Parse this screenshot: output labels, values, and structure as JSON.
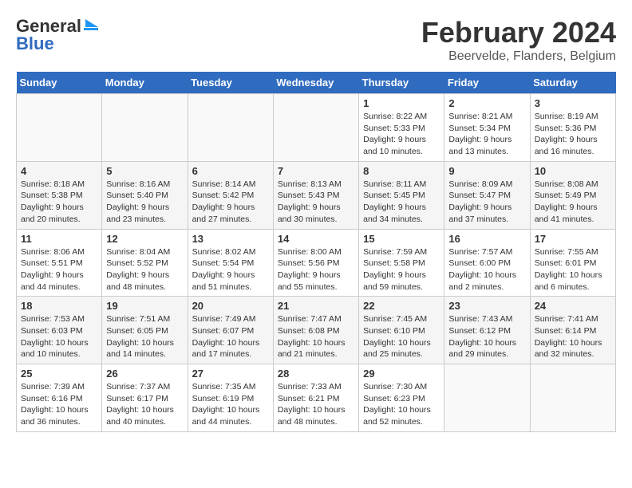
{
  "logo": {
    "line1": "General",
    "line2": "Blue"
  },
  "title": "February 2024",
  "subtitle": "Beervelde, Flanders, Belgium",
  "weekdays": [
    "Sunday",
    "Monday",
    "Tuesday",
    "Wednesday",
    "Thursday",
    "Friday",
    "Saturday"
  ],
  "weeks": [
    [
      {
        "day": "",
        "info": ""
      },
      {
        "day": "",
        "info": ""
      },
      {
        "day": "",
        "info": ""
      },
      {
        "day": "",
        "info": ""
      },
      {
        "day": "1",
        "info": "Sunrise: 8:22 AM\nSunset: 5:33 PM\nDaylight: 9 hours and 10 minutes."
      },
      {
        "day": "2",
        "info": "Sunrise: 8:21 AM\nSunset: 5:34 PM\nDaylight: 9 hours and 13 minutes."
      },
      {
        "day": "3",
        "info": "Sunrise: 8:19 AM\nSunset: 5:36 PM\nDaylight: 9 hours and 16 minutes."
      }
    ],
    [
      {
        "day": "4",
        "info": "Sunrise: 8:18 AM\nSunset: 5:38 PM\nDaylight: 9 hours and 20 minutes."
      },
      {
        "day": "5",
        "info": "Sunrise: 8:16 AM\nSunset: 5:40 PM\nDaylight: 9 hours and 23 minutes."
      },
      {
        "day": "6",
        "info": "Sunrise: 8:14 AM\nSunset: 5:42 PM\nDaylight: 9 hours and 27 minutes."
      },
      {
        "day": "7",
        "info": "Sunrise: 8:13 AM\nSunset: 5:43 PM\nDaylight: 9 hours and 30 minutes."
      },
      {
        "day": "8",
        "info": "Sunrise: 8:11 AM\nSunset: 5:45 PM\nDaylight: 9 hours and 34 minutes."
      },
      {
        "day": "9",
        "info": "Sunrise: 8:09 AM\nSunset: 5:47 PM\nDaylight: 9 hours and 37 minutes."
      },
      {
        "day": "10",
        "info": "Sunrise: 8:08 AM\nSunset: 5:49 PM\nDaylight: 9 hours and 41 minutes."
      }
    ],
    [
      {
        "day": "11",
        "info": "Sunrise: 8:06 AM\nSunset: 5:51 PM\nDaylight: 9 hours and 44 minutes."
      },
      {
        "day": "12",
        "info": "Sunrise: 8:04 AM\nSunset: 5:52 PM\nDaylight: 9 hours and 48 minutes."
      },
      {
        "day": "13",
        "info": "Sunrise: 8:02 AM\nSunset: 5:54 PM\nDaylight: 9 hours and 51 minutes."
      },
      {
        "day": "14",
        "info": "Sunrise: 8:00 AM\nSunset: 5:56 PM\nDaylight: 9 hours and 55 minutes."
      },
      {
        "day": "15",
        "info": "Sunrise: 7:59 AM\nSunset: 5:58 PM\nDaylight: 9 hours and 59 minutes."
      },
      {
        "day": "16",
        "info": "Sunrise: 7:57 AM\nSunset: 6:00 PM\nDaylight: 10 hours and 2 minutes."
      },
      {
        "day": "17",
        "info": "Sunrise: 7:55 AM\nSunset: 6:01 PM\nDaylight: 10 hours and 6 minutes."
      }
    ],
    [
      {
        "day": "18",
        "info": "Sunrise: 7:53 AM\nSunset: 6:03 PM\nDaylight: 10 hours and 10 minutes."
      },
      {
        "day": "19",
        "info": "Sunrise: 7:51 AM\nSunset: 6:05 PM\nDaylight: 10 hours and 14 minutes."
      },
      {
        "day": "20",
        "info": "Sunrise: 7:49 AM\nSunset: 6:07 PM\nDaylight: 10 hours and 17 minutes."
      },
      {
        "day": "21",
        "info": "Sunrise: 7:47 AM\nSunset: 6:08 PM\nDaylight: 10 hours and 21 minutes."
      },
      {
        "day": "22",
        "info": "Sunrise: 7:45 AM\nSunset: 6:10 PM\nDaylight: 10 hours and 25 minutes."
      },
      {
        "day": "23",
        "info": "Sunrise: 7:43 AM\nSunset: 6:12 PM\nDaylight: 10 hours and 29 minutes."
      },
      {
        "day": "24",
        "info": "Sunrise: 7:41 AM\nSunset: 6:14 PM\nDaylight: 10 hours and 32 minutes."
      }
    ],
    [
      {
        "day": "25",
        "info": "Sunrise: 7:39 AM\nSunset: 6:16 PM\nDaylight: 10 hours and 36 minutes."
      },
      {
        "day": "26",
        "info": "Sunrise: 7:37 AM\nSunset: 6:17 PM\nDaylight: 10 hours and 40 minutes."
      },
      {
        "day": "27",
        "info": "Sunrise: 7:35 AM\nSunset: 6:19 PM\nDaylight: 10 hours and 44 minutes."
      },
      {
        "day": "28",
        "info": "Sunrise: 7:33 AM\nSunset: 6:21 PM\nDaylight: 10 hours and 48 minutes."
      },
      {
        "day": "29",
        "info": "Sunrise: 7:30 AM\nSunset: 6:23 PM\nDaylight: 10 hours and 52 minutes."
      },
      {
        "day": "",
        "info": ""
      },
      {
        "day": "",
        "info": ""
      }
    ]
  ]
}
